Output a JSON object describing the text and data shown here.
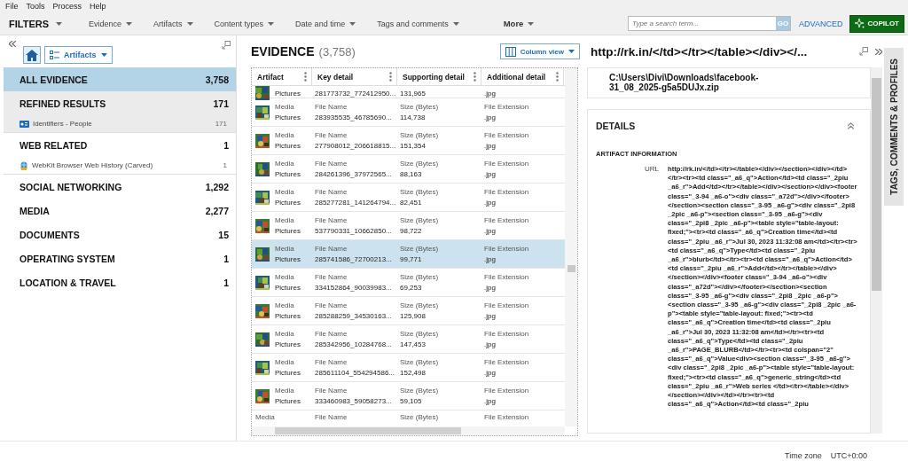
{
  "menu": [
    "File",
    "Tools",
    "Process",
    "Help"
  ],
  "filters": {
    "title": "FILTERS",
    "items": [
      {
        "label": "Evidence",
        "kind": "dropdown"
      },
      {
        "label": "Artifacts",
        "kind": "dropdown"
      },
      {
        "label": "Content types",
        "kind": "dropdown"
      },
      {
        "label": "Date and time",
        "kind": "dropdown"
      },
      {
        "label": "Tags and comments",
        "kind": "dropdown"
      },
      {
        "label": "More",
        "kind": "more"
      }
    ],
    "search": {
      "placeholder": "Type a search term...",
      "button": "GO"
    },
    "advanced": "ADVANCED",
    "copilot": "COPILOT"
  },
  "sidebar": {
    "view": "Artifacts",
    "items": [
      {
        "label": "ALL EVIDENCE",
        "count": "3,758",
        "selected": true,
        "hovered": false
      },
      {
        "label": "REFINED RESULTS",
        "count": "171",
        "selected": false,
        "hovered": true,
        "children": [
          {
            "label": "Identifiers - People",
            "count": "171",
            "kind": "card",
            "selected": false
          }
        ]
      },
      {
        "label": "WEB RELATED",
        "count": "1",
        "selected": false,
        "hovered": false,
        "children": [
          {
            "label": "WebKit Browser Web History (Carved)",
            "count": "1",
            "kind": "globe",
            "selected": false
          }
        ]
      },
      {
        "label": "SOCIAL NETWORKING",
        "count": "1,292",
        "selected": false,
        "hovered": false
      },
      {
        "label": "MEDIA",
        "count": "2,277",
        "selected": false,
        "hovered": false
      },
      {
        "label": "DOCUMENTS",
        "count": "15",
        "selected": false,
        "hovered": false
      },
      {
        "label": "OPERATING SYSTEM",
        "count": "1",
        "selected": false,
        "hovered": false
      },
      {
        "label": "LOCATION & TRAVEL",
        "count": "1",
        "selected": false,
        "hovered": false
      }
    ]
  },
  "evidence": {
    "title": "EVIDENCE",
    "count": "(3,758)",
    "view": "Column view",
    "columns": [
      "Artifact",
      "Key detail",
      "Supporting detail",
      "Additional detail"
    ],
    "rows": [
      {
        "type": "Pictures",
        "key": "281773732_772412950...",
        "sup": "131,965",
        "add": ".jpg",
        "selected": false
      },
      {
        "category": "Media",
        "type": "Pictures",
        "key_label": "File Name",
        "key": "283935535_46785690...",
        "sup_label": "Size (Bytes)",
        "sup": "114,738",
        "add_label": "File Extension",
        "add": ".jpg",
        "selected": false
      },
      {
        "category": "Media",
        "type": "Pictures",
        "key_label": "File Name",
        "key": "277908012_206618815...",
        "sup_label": "Size (Bytes)",
        "sup": "151,354",
        "add_label": "File Extension",
        "add": ".jpg",
        "selected": false
      },
      {
        "category": "Media",
        "type": "Pictures",
        "key_label": "File Name",
        "key": "284261396_37972565...",
        "sup_label": "Size (Bytes)",
        "sup": "88,163",
        "add_label": "File Extension",
        "add": ".jpg",
        "selected": false
      },
      {
        "category": "Media",
        "type": "Pictures",
        "key_label": "File Name",
        "key": "285277281_141264794...",
        "sup_label": "Size (Bytes)",
        "sup": "82,451",
        "add_label": "File Extension",
        "add": ".jpg",
        "selected": false
      },
      {
        "category": "Media",
        "type": "Pictures",
        "key_label": "File Name",
        "key": "537790331_10662850...",
        "sup_label": "Size (Bytes)",
        "sup": "98,722",
        "add_label": "File Extension",
        "add": ".jpg",
        "selected": false
      },
      {
        "category": "Media",
        "type": "Pictures",
        "key_label": "File Name",
        "key": "285741586_72700213...",
        "sup_label": "Size (Bytes)",
        "sup": "99,771",
        "add_label": "File Extension",
        "add": ".jpg",
        "selected": true
      },
      {
        "category": "Media",
        "type": "Pictures",
        "key_label": "File Name",
        "key": "334152864_90039983...",
        "sup_label": "Size (Bytes)",
        "sup": "69,253",
        "add_label": "File Extension",
        "add": ".jpg",
        "selected": false
      },
      {
        "category": "Media",
        "type": "Pictures",
        "key_label": "File Name",
        "key": "285288259_34530163...",
        "sup_label": "Size (Bytes)",
        "sup": "125,908",
        "add_label": "File Extension",
        "add": ".jpg",
        "selected": false
      },
      {
        "category": "Media",
        "type": "Pictures",
        "key_label": "File Name",
        "key": "285342956_10284768...",
        "sup_label": "Size (Bytes)",
        "sup": "147,453",
        "add_label": "File Extension",
        "add": ".jpg",
        "selected": false
      },
      {
        "category": "Media",
        "type": "Pictures",
        "key_label": "File Name",
        "key": "285611104_554294586...",
        "sup_label": "Size (Bytes)",
        "sup": "152,498",
        "add_label": "File Extension",
        "add": ".jpg",
        "selected": false
      },
      {
        "category": "Media",
        "type": "Pictures",
        "key_label": "File Name",
        "key": "333460983_59058273...",
        "sup_label": "Size (Bytes)",
        "sup": "59,105",
        "add_label": "File Extension",
        "add": ".jpg",
        "selected": false
      },
      {
        "category": "Media",
        "key_label": "File Name",
        "sup_label": "Size (Bytes)",
        "add_label": "File Extension",
        "selected": false
      }
    ]
  },
  "details": {
    "title": "http://rk.in/</td></tr></table></div></...",
    "source_lines": [
      "C:\\Users\\Divi\\Downloads\\facebook-",
      "31_08_2025-g5a5DUJx.zip"
    ],
    "section": "DETAILS",
    "group": "ARTIFACT INFORMATION",
    "fields": [
      {
        "label": "URL",
        "value": "http://rk.in/</td></tr></table></div></section></div></td></tr><tr><td class=\"_a6_q\">Action</td><td class=\"_2piu _a6_r\">Add</td></tr></table></div></section></div><footer class=\"_3-94 _a6-o\"><div class=\"_a72d\"></div></footer></section><section class=\"_3-95 _a6-g\"><div class=\"_2pi8 _2pic _a6-p\"><section class=\"_3-95 _a6-g\"><div class=\"_2pi8 _2pic _a6-p\"><table style=\"table-layout: fixed;\"><tr><td class=\"_a6_q\">Creation time</td><td class=\"_2piu _a6_r\">Jul 30, 2023 11:32:08 am</td></tr><tr><td class=\"_a6_q\">Type</td><td class=\"_2piu _a6_r\">blurb</td></tr><tr><td class=\"_a6_q\">Action</td><td class=\"_2piu _a6_r\">Add</td></tr></table></div></section></div><footer class=\"_3-94 _a6-o\"><div class=\"_a72d\"></div></footer></section><section class=\"_3-95 _a6-g\"><div class=\"_2pi8 _2pic _a6-p\"><section class=\"_3-95 _a6-g\"><div class=\"_2pi8 _2pic _a6-p\"><table style=\"table-layout: fixed;\"><tr><td class=\"_a6_q\">Creation time</td><td class=\"_2piu _a6_r\">Jul 30, 2023 11:32:08 am</td></tr><tr><td class=\"_a6_q\">Type</td><td class=\"_2piu _a6_r\">PAGE_BLURB</td></tr><tr><td colspan=\"2\" class=\"_a6_q\">Value<div><section class=\"_3-95 _a6-g\"><div class=\"_2pi8 _2pic _a6-p\"><table style=\"table-layout: fixed;\"><tr><td class=\"_a6_q\">generic_string</td><td class=\"_2piu _a6_r\">Web series </td></tr></table></div></section></div></td></tr><tr><td class=\"_a6_q\">Action</td><td class=\"_2piu"
      }
    ]
  },
  "side_tab": "TAGS, COMMENTS & PROFILES",
  "footer": {
    "label": "Time zone",
    "value": "UTC+0:00"
  }
}
